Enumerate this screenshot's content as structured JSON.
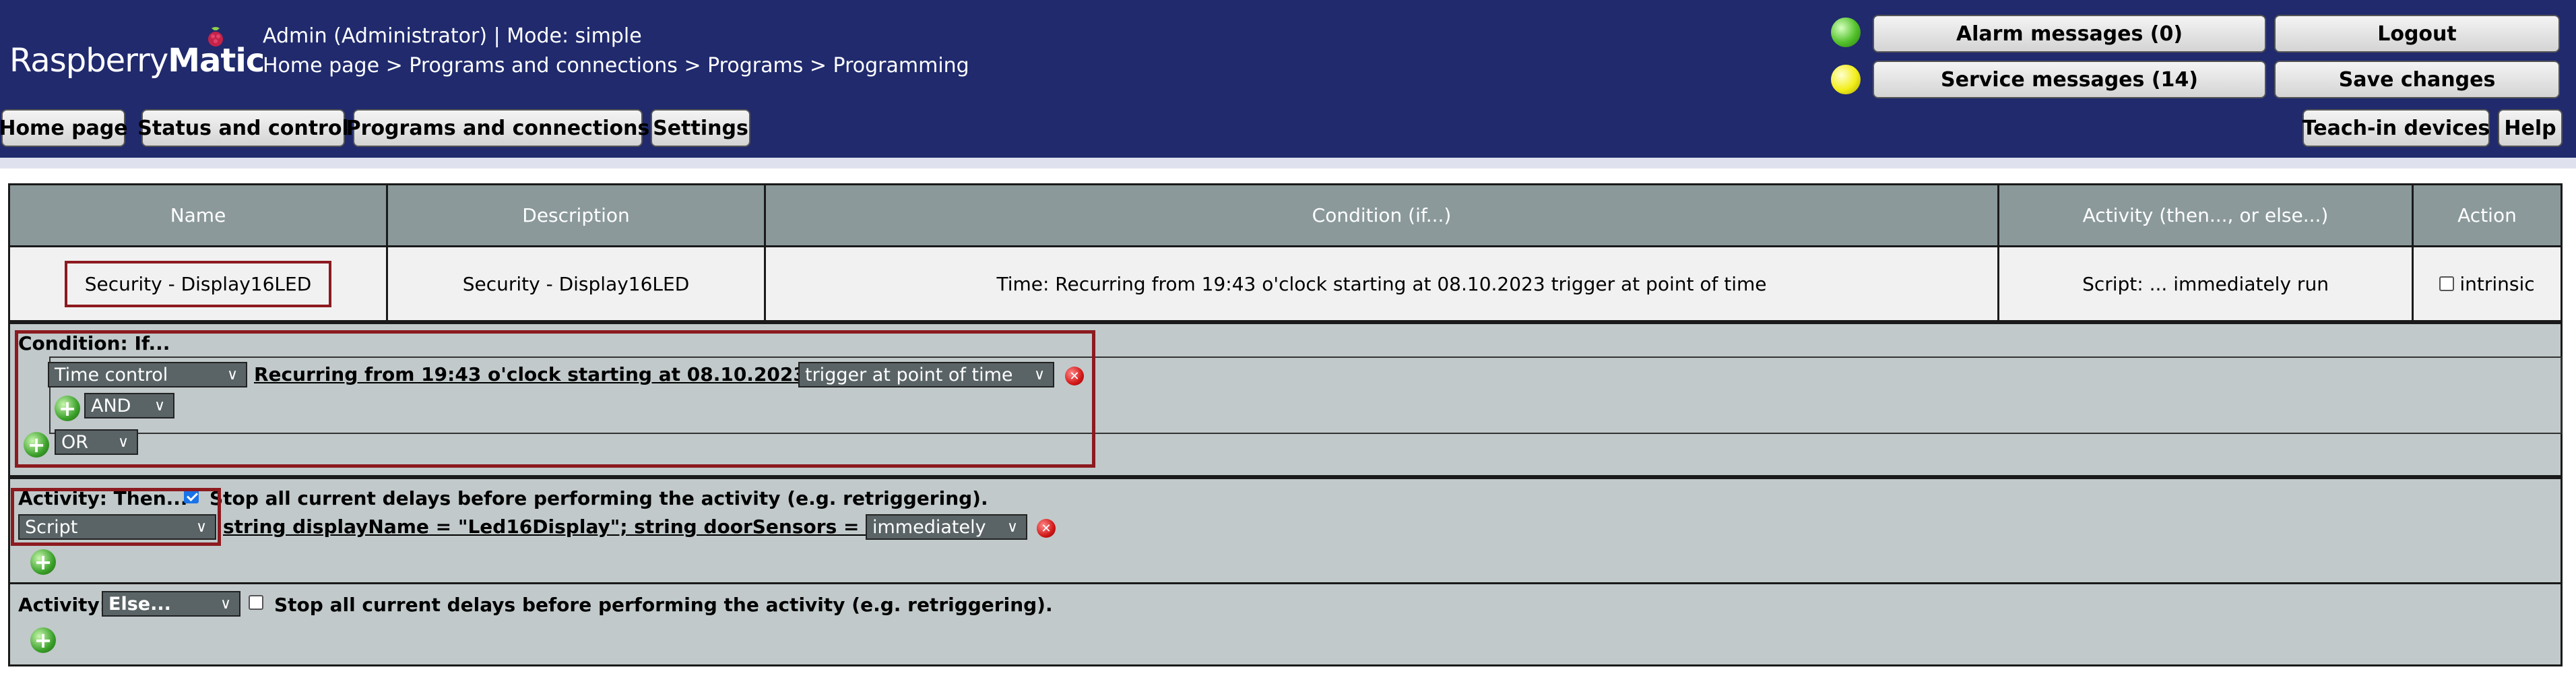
{
  "header": {
    "logo_light": "Raspberry",
    "logo_bold": "Matic",
    "user_mode": "Admin (Administrator) | Mode: simple",
    "breadcrumb": "Home page > Programs and connections > Programs > Programming",
    "alarm_messages": "Alarm messages (0)",
    "service_messages": "Service messages (14)",
    "logout": "Logout",
    "save_changes": "Save changes",
    "status_colors": {
      "alarm": "#52c12a",
      "service": "#f2ee1a"
    }
  },
  "nav": {
    "home": "Home page",
    "status": "Status and control",
    "programs": "Programs and connections",
    "settings": "Settings",
    "teach_in": "Teach-in devices",
    "help": "Help"
  },
  "table": {
    "headers": {
      "name": "Name",
      "description": "Description",
      "condition": "Condition (if...)",
      "activity": "Activity (then..., or else...)",
      "action": "Action"
    },
    "row": {
      "name": "Security - Display16LED",
      "description": "Security - Display16LED",
      "condition": "Time: Recurring from 19:43 o'clock starting at 08.10.2023 trigger at point of time",
      "activity": "Script: ... immediately run",
      "action_label": "intrinsic"
    }
  },
  "condition": {
    "title": "Condition: If...",
    "type_select": "Time control",
    "time_link": "Recurring from 19:43 o'clock starting at 08.10.2023",
    "trigger_select": "trigger at point of time",
    "and_select": "AND",
    "or_select": "OR"
  },
  "then_activity": {
    "title": "Activity: Then...",
    "stop_delays": "Stop all current delays before performing the activity (e.g. retriggering).",
    "type_select": "Script",
    "script_link": "string displayName = \"Led16Display\"; string doorSensors = ...",
    "timing_select": "immediately"
  },
  "else_activity": {
    "title": "Activity:",
    "else_select": "Else...",
    "stop_delays": "Stop all current delays before performing the activity (e.g. retriggering)."
  },
  "colors": {
    "header_bg": "#202a6d",
    "table_header": "#8b999b",
    "panel_bg": "#c1c9ca",
    "highlight": "#8c1a1f"
  }
}
